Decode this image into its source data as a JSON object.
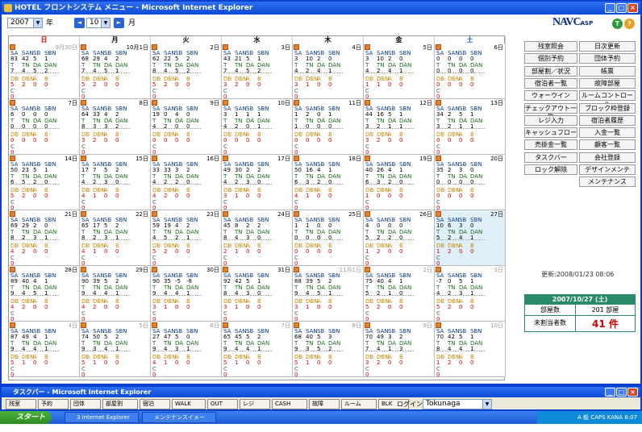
{
  "window": {
    "title": "HOTEL フロントシステム メニュー - Microsoft Internet Explorer"
  },
  "controls": {
    "year": "2007",
    "year_unit": "年",
    "month": "10",
    "month_unit": "月",
    "prev": "◄",
    "next": "►"
  },
  "logo": {
    "text": "NAVC",
    "sub": "ASP"
  },
  "weekdays": [
    "日",
    "月",
    "火",
    "水",
    "木",
    "金",
    "土"
  ],
  "weekday_colors": [
    "#d00000",
    "#000000",
    "#000000",
    "#000000",
    "#000000",
    "#000000",
    "#1a5ad0"
  ],
  "labels": {
    "row1": [
      "SA",
      "SAN",
      "SB",
      "SBN"
    ],
    "row3": [
      "T",
      "TN",
      "DA",
      "DAN"
    ],
    "row5": [
      "DB",
      "DBN",
      "A",
      "B"
    ],
    "row7": "C"
  },
  "weeks": [
    [
      {
        "d": "9月30日",
        "gray": true,
        "v1": [
          "83",
          "42",
          "5",
          "1"
        ],
        "v3": [
          "7",
          "4",
          "5",
          "2"
        ],
        "v4": [
          "",
          "",
          "",
          ""
        ],
        "v5": [
          "5",
          "2",
          "0",
          "0"
        ],
        "v7": "0"
      },
      {
        "d": "10月1日",
        "v1": [
          "68",
          "29",
          "4",
          "2"
        ],
        "v3": [
          "7",
          "4",
          "5",
          "1"
        ],
        "v5": [
          "5",
          "2",
          "0",
          "0"
        ],
        "v7": "0"
      },
      {
        "d": "2日",
        "v1": [
          "62",
          "22",
          "5",
          "2"
        ],
        "v3": [
          "8",
          "4",
          "5",
          "2"
        ],
        "v5": [
          "5",
          "2",
          "0",
          "0"
        ],
        "v7": "0"
      },
      {
        "d": "3日",
        "v1": [
          "43",
          "21",
          "5",
          "1"
        ],
        "v3": [
          "7",
          "4",
          "5",
          "2"
        ],
        "v5": [
          "3",
          "2",
          "0",
          "0"
        ],
        "v7": "0"
      },
      {
        "d": "4日",
        "v1": [
          "3",
          "10",
          "2",
          "0"
        ],
        "v3": [
          "4",
          "2",
          "4",
          "1"
        ],
        "v5": [
          "3",
          "1",
          "0",
          "0"
        ],
        "v7": "0"
      },
      {
        "d": "5日",
        "v1": [
          "3",
          "10",
          "2",
          "0"
        ],
        "v3": [
          "4",
          "2",
          "4",
          "1"
        ],
        "v5": [
          "1",
          "1",
          "0",
          "0"
        ],
        "v7": "0"
      },
      {
        "d": "6日",
        "v1": [
          "0",
          "0",
          "0",
          "0"
        ],
        "v3": [
          "0",
          "0",
          "0",
          "0"
        ],
        "v5": [
          "0",
          "0",
          "0",
          "0"
        ],
        "v7": "0"
      }
    ],
    [
      {
        "d": "7日",
        "v1": [
          "6",
          "0",
          "0",
          "0"
        ],
        "v3": [
          "0",
          "0",
          "0",
          "0"
        ],
        "v5": [
          "0",
          "0",
          "0",
          "0"
        ],
        "v7": "0"
      },
      {
        "d": "8日",
        "v1": [
          "64",
          "33",
          "4",
          "2"
        ],
        "v3": [
          "8",
          "3",
          "3",
          "2"
        ],
        "v5": [
          "3",
          "2",
          "0",
          "0"
        ],
        "v7": "0"
      },
      {
        "d": "9日",
        "v1": [
          "19",
          "0",
          "4",
          "0"
        ],
        "v3": [
          "4",
          "2",
          "0",
          "0"
        ],
        "v5": [
          "0",
          "0",
          "0",
          "0"
        ],
        "v7": "0"
      },
      {
        "d": "10日",
        "v1": [
          "3",
          "1",
          "1",
          "1"
        ],
        "v3": [
          "4",
          "2",
          "0",
          "1"
        ],
        "v5": [
          "0",
          "0",
          "0",
          "0"
        ],
        "v7": "0"
      },
      {
        "d": "11日",
        "v1": [
          "1",
          "2",
          "0",
          "1"
        ],
        "v3": [
          "1",
          "0",
          "0",
          "0"
        ],
        "v5": [
          "0",
          "0",
          "0",
          "0"
        ],
        "v7": "0"
      },
      {
        "d": "12日",
        "v1": [
          "44",
          "16",
          "5",
          "1"
        ],
        "v3": [
          "3",
          "2",
          "1",
          "1"
        ],
        "v5": [
          "3",
          "2",
          "0",
          "0"
        ],
        "v7": "0"
      },
      {
        "d": "13日",
        "v1": [
          "34",
          "2",
          "5",
          "1"
        ],
        "v3": [
          "3",
          "2",
          "1",
          "1"
        ],
        "v5": [
          "0",
          "0",
          "0",
          "0"
        ],
        "v7": "0"
      }
    ],
    [
      {
        "d": "14日",
        "v1": [
          "50",
          "23",
          "5",
          "1"
        ],
        "v3": [
          "6",
          "5",
          "2",
          "0"
        ],
        "v5": [
          "5",
          "2",
          "0",
          "0"
        ],
        "v7": "0"
      },
      {
        "d": "15日",
        "v1": [
          "17",
          "7",
          "5",
          "2"
        ],
        "v3": [
          "4",
          "2",
          "3",
          "0"
        ],
        "v5": [
          "4",
          "1",
          "0",
          "0"
        ],
        "v7": "0"
      },
      {
        "d": "16日",
        "v1": [
          "33",
          "33",
          "3",
          "2"
        ],
        "v3": [
          "4",
          "2",
          "2",
          "0"
        ],
        "v5": [
          "4",
          "2",
          "0",
          "0"
        ],
        "v7": "0"
      },
      {
        "d": "17日",
        "v1": [
          "49",
          "30",
          "2",
          "2"
        ],
        "v3": [
          "4",
          "2",
          "3",
          "0"
        ],
        "v5": [
          "3",
          "1",
          "0",
          "0"
        ],
        "v7": "0"
      },
      {
        "d": "18日",
        "v1": [
          "50",
          "16",
          "4",
          "1"
        ],
        "v3": [
          "6",
          "3",
          "2",
          "0"
        ],
        "v5": [
          "4",
          "1",
          "0",
          "0"
        ],
        "v7": "0"
      },
      {
        "d": "19日",
        "v1": [
          "40",
          "26",
          "4",
          "1"
        ],
        "v3": [
          "6",
          "3",
          "2",
          "0"
        ],
        "v5": [
          "1",
          "0",
          "0",
          "0"
        ],
        "v7": "0"
      },
      {
        "d": "20日",
        "v1": [
          "35",
          "2",
          "3",
          "0"
        ],
        "v3": [
          "0",
          "0",
          "0",
          "0"
        ],
        "v5": [
          "0",
          "0",
          "0",
          "0"
        ],
        "v7": "0"
      }
    ],
    [
      {
        "d": "21日",
        "v1": [
          "69",
          "29",
          "2",
          "0"
        ],
        "v3": [
          "8",
          "2",
          "3",
          "1"
        ],
        "v5": [
          "4",
          "2",
          "0",
          "0"
        ],
        "v7": "0"
      },
      {
        "d": "22日",
        "v1": [
          "65",
          "17",
          "5",
          "2"
        ],
        "v3": [
          "8",
          "2",
          "3",
          "1"
        ],
        "v5": [
          "4",
          "1",
          "0",
          "0"
        ],
        "v7": "0"
      },
      {
        "d": "23日",
        "v1": [
          "59",
          "19",
          "4",
          "2"
        ],
        "v3": [
          "4",
          "5",
          "2",
          "1"
        ],
        "v5": [
          "5",
          "2",
          "0",
          "0"
        ],
        "v7": "0"
      },
      {
        "d": "24日",
        "v1": [
          "45",
          "8",
          "2",
          "2"
        ],
        "v3": [
          "8",
          "4",
          "3",
          "0"
        ],
        "v5": [
          "2",
          "1",
          "0",
          "0"
        ],
        "v7": "0"
      },
      {
        "d": "25日",
        "v1": [
          "1",
          "1",
          "0",
          "0"
        ],
        "v3": [
          "0",
          "0",
          "0",
          "0"
        ],
        "v5": [
          "0",
          "0",
          "0",
          "0"
        ],
        "v7": "0"
      },
      {
        "d": "26日",
        "v1": [
          "4",
          "0",
          "0",
          "0"
        ],
        "v3": [
          "5",
          "2",
          "2",
          "0"
        ],
        "v5": [
          "1",
          "2",
          "0",
          "0"
        ],
        "v7": "0"
      },
      {
        "d": "27日",
        "today": true,
        "v1": [
          "10",
          "6",
          "3",
          "0"
        ],
        "v3": [
          "5",
          "2",
          "4",
          "1"
        ],
        "v5": [
          "1",
          "2",
          "0",
          "0"
        ],
        "v7": "0"
      }
    ],
    [
      {
        "d": "28日",
        "v1": [
          "89",
          "40",
          "4",
          "1"
        ],
        "v3": [
          "9",
          "4",
          "5",
          "1"
        ],
        "v5": [
          "4",
          "2",
          "0",
          "0"
        ],
        "v7": "0"
      },
      {
        "d": "29日",
        "v1": [
          "90",
          "39",
          "5",
          "2"
        ],
        "v3": [
          "9",
          "4",
          "4",
          "1"
        ],
        "v5": [
          "4",
          "2",
          "0",
          "0"
        ],
        "v7": "0"
      },
      {
        "d": "30日",
        "v1": [
          "90",
          "35",
          "-5",
          "-8"
        ],
        "v3": [
          "9",
          "4",
          "4",
          "1"
        ],
        "v5": [
          "3",
          "1",
          "0",
          "0"
        ],
        "v7": "0"
      },
      {
        "d": "31日",
        "v1": [
          "92",
          "42",
          "5",
          "1"
        ],
        "v3": [
          "8",
          "4",
          "3",
          "0"
        ],
        "v5": [
          "3",
          "1",
          "0",
          "0"
        ],
        "v7": "0"
      },
      {
        "d": "11月1日",
        "gray": true,
        "v1": [
          "88",
          "39",
          "5",
          "2"
        ],
        "v3": [
          "9",
          "4",
          "5",
          "1"
        ],
        "v5": [
          "3",
          "1",
          "0",
          "0"
        ],
        "v7": "0"
      },
      {
        "d": "2日",
        "gray": true,
        "v1": [
          "75",
          "40",
          "4",
          "1"
        ],
        "v3": [
          "5",
          "2",
          "1",
          "0"
        ],
        "v5": [
          "5",
          "2",
          "0",
          "0"
        ],
        "v7": "0"
      },
      {
        "d": "3日",
        "gray": true,
        "v1": [
          "-7",
          "0",
          "5",
          "1"
        ],
        "v3": [
          "4",
          "2",
          "3",
          "1"
        ],
        "v5": [
          "5",
          "2",
          "0",
          "0"
        ],
        "v7": "0"
      }
    ],
    [
      {
        "d": "4日",
        "gray": true,
        "v1": [
          "87",
          "49",
          "4",
          "1"
        ],
        "v3": [
          "9",
          "4",
          "4",
          "1"
        ],
        "v5": [
          "5",
          "1",
          "0",
          "0"
        ],
        "v7": "0"
      },
      {
        "d": "5日",
        "gray": true,
        "v1": [
          "74",
          "50",
          "5",
          "2"
        ],
        "v3": [
          "9",
          "3",
          "4",
          "1"
        ],
        "v5": [
          "5",
          "1",
          "0",
          "0"
        ],
        "v7": "0"
      },
      {
        "d": "6日",
        "gray": true,
        "v1": [
          "27",
          "47",
          "5",
          "0"
        ],
        "v3": [
          "9",
          "4",
          "3",
          "1"
        ],
        "v5": [
          "4",
          "1",
          "0",
          "0"
        ],
        "v7": "0"
      },
      {
        "d": "7日",
        "gray": true,
        "v1": [
          "65",
          "45",
          "5",
          "2"
        ],
        "v3": [
          "9",
          "4",
          "4",
          "1"
        ],
        "v5": [
          "5",
          "1",
          "0",
          "0"
        ],
        "v7": "0"
      },
      {
        "d": "8日",
        "gray": true,
        "v1": [
          "68",
          "40",
          "5",
          "3"
        ],
        "v3": [
          "9",
          "3",
          "5",
          "2"
        ],
        "v5": [
          "5",
          "1",
          "0",
          "0"
        ],
        "v7": "0"
      },
      {
        "d": "9日",
        "gray": true,
        "v1": [
          "70",
          "49",
          "3",
          "2"
        ],
        "v3": [
          "7",
          "4",
          "1",
          "3"
        ],
        "v5": [
          "3",
          "2",
          "0",
          "0"
        ],
        "v7": "0"
      },
      {
        "d": "10日",
        "gray": true,
        "v1": [
          "70",
          "42",
          "5",
          "1"
        ],
        "v3": [
          "8",
          "4",
          "4",
          "1"
        ],
        "v5": [
          "1",
          "2",
          "0",
          "0"
        ],
        "v7": "0"
      }
    ]
  ],
  "menu_left": [
    "残室照会",
    "個別予約",
    "部屋割／状況",
    "宿泊者一覧",
    "ウォーウイン",
    "チェックアウト一覧",
    "レジ入力",
    "キャッシュフロー",
    "売掛金一覧",
    "タスクバー",
    "ロック解除"
  ],
  "menu_right": [
    "日次更新",
    "団体予約",
    "帳票",
    "故障部屋",
    "ルームコントロール",
    "ブロック枠登録",
    "宿泊者履歴",
    "入金一覧",
    "顧客一覧",
    "会社登録",
    "デザインメンテ",
    "メンテナンス"
  ],
  "updated": "更新:2008/01/23 08:06",
  "info": {
    "date": "2007/10/27 (土)",
    "rooms_label": "部屋数",
    "rooms_value": "201 部屋",
    "unassigned_label": "未割当者数",
    "unassigned_value": "41 件"
  },
  "taskbar_window": {
    "title": "タスクバー - Microsoft Internet Explorer",
    "buttons": [
      "残室",
      "予約",
      "団体",
      "部屋割",
      "宿泊",
      "WALK",
      "OUT",
      "レジ",
      "CASH",
      "故障",
      "ルーム",
      "BLK"
    ],
    "login_label": "ログイン",
    "login_value": "Tokunaga"
  },
  "os_taskbar": {
    "start": "スタート",
    "items": [
      "3 Internet Explorer",
      "メンテナンスイメージ.P..."
    ],
    "tray": "A 般 CAPS KANA 8:07"
  }
}
